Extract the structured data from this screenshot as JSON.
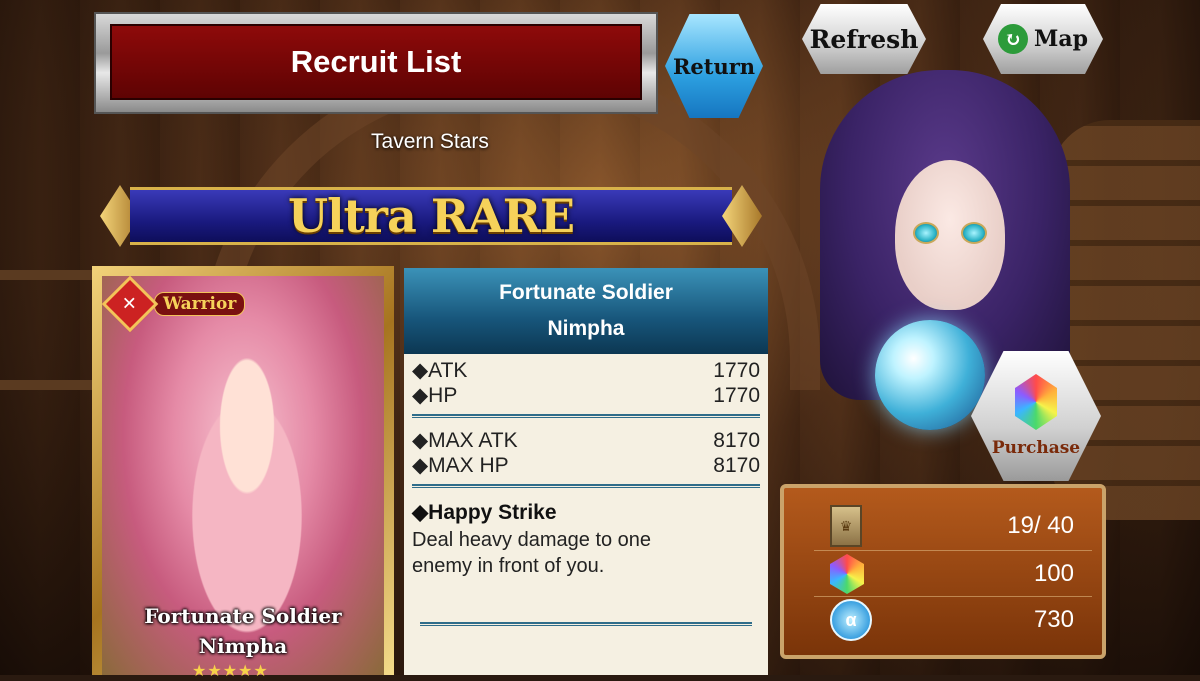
{
  "header": {
    "title": "Recruit List",
    "return_label": "Return",
    "refresh_label": "Refresh",
    "map_label": "Map"
  },
  "subtitle": "Tavern Stars",
  "rarity": "Ultra RARE",
  "card": {
    "class": "Warrior",
    "name_line1": "Fortunate Soldier",
    "name_line2": "Nimpha",
    "stars": 5
  },
  "info": {
    "title_line1": "Fortunate Soldier",
    "title_line2": "Nimpha",
    "stats": [
      {
        "label": "◆ATK",
        "value": "1770"
      },
      {
        "label": "◆HP",
        "value": "1770"
      }
    ],
    "max_stats": [
      {
        "label": "◆MAX ATK",
        "value": "8170"
      },
      {
        "label": "◆MAX HP",
        "value": "8170"
      }
    ],
    "skill_name": "◆Happy Strike",
    "skill_desc": "Deal heavy damage to one enemy in front of you."
  },
  "purchase_label": "Purchase",
  "currency": {
    "tickets": "19/ 40",
    "crystals": "100",
    "coins": "730"
  },
  "colors": {
    "title_red": "#7a0606",
    "rarity_blue": "#1a1a80",
    "rarity_gold": "#f6d25a",
    "panel_teal": "#17557a",
    "currency_brown": "#9a4512"
  }
}
